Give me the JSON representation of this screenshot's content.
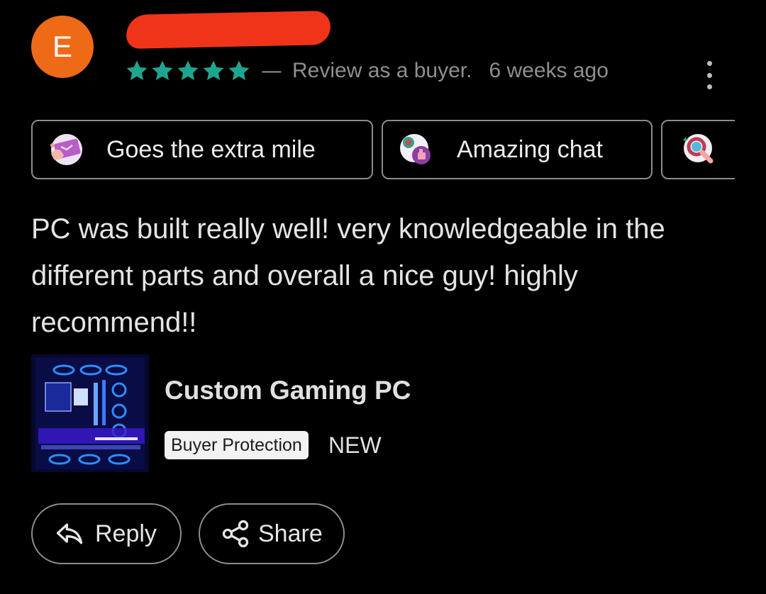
{
  "reviewer": {
    "initial": "E"
  },
  "rating": {
    "stars": 5,
    "star_color": "#1fa58f",
    "separator": "—",
    "review_type": "Review as a buyer.",
    "time_ago": "6 weeks ago"
  },
  "tags": [
    {
      "label": "Goes the extra mile",
      "icon": "extra-mile-icon"
    },
    {
      "label": "Amazing chat",
      "icon": "amazing-chat-icon"
    },
    {
      "label": "",
      "icon": "magnifier-icon"
    }
  ],
  "review_text": "PC was built really well! very knowledgeable in the different parts and overall a nice guy! highly recommend!!",
  "product": {
    "title": "Custom Gaming PC",
    "badge": "Buyer Protection",
    "condition": "NEW"
  },
  "actions": {
    "reply_label": "Reply",
    "share_label": "Share"
  },
  "colors": {
    "avatar": "#ef6a17",
    "redaction": "#f0341a",
    "background": "#000000"
  }
}
